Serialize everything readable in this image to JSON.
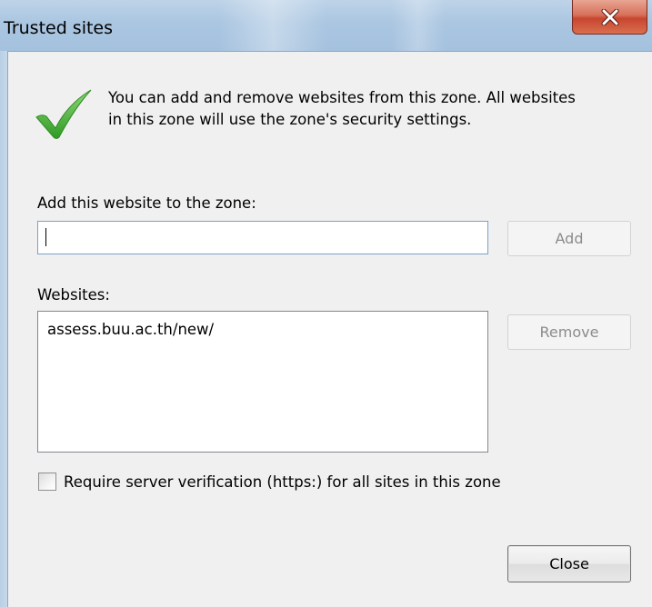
{
  "window": {
    "title": "Trusted sites"
  },
  "intro": {
    "line1": "You can add and remove websites from this zone. All websites",
    "line2": "in this zone will use the zone's security settings."
  },
  "add": {
    "label": "Add this website to the zone:",
    "value": "",
    "button": "Add"
  },
  "websites": {
    "label": "Websites:",
    "items": [
      "assess.buu.ac.th/new/"
    ],
    "remove_button": "Remove"
  },
  "verification": {
    "label": "Require server verification (https:) for all sites in this zone",
    "checked": false
  },
  "close_button": "Close",
  "colors": {
    "checkmark": "#3fae2f",
    "close_x": "#c7452f",
    "titlebar": "#aac6e1"
  }
}
